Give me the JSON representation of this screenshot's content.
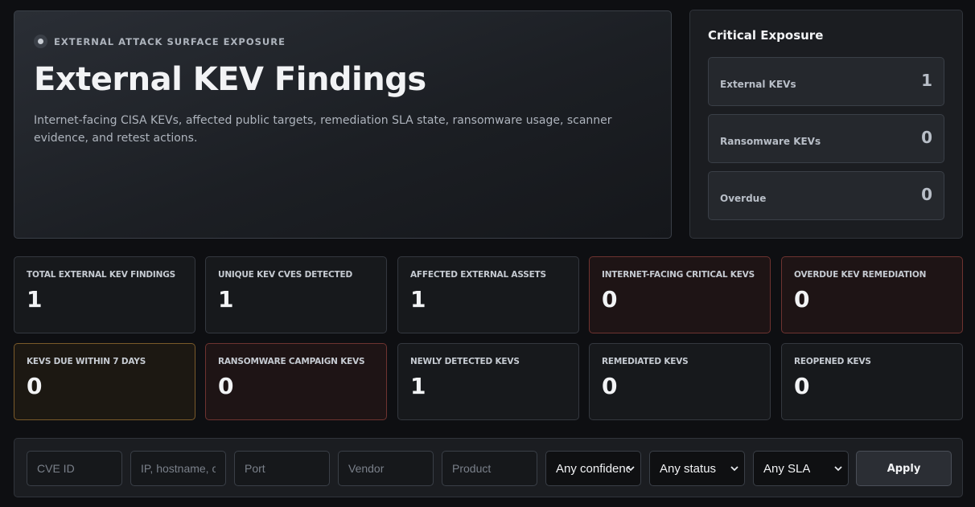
{
  "hero": {
    "eyebrow": "EXTERNAL ATTACK SURFACE EXPOSURE",
    "title": "External KEV Findings",
    "description": "Internet-facing CISA KEVs, affected public targets, remediation SLA state, ransomware usage, scanner evidence, and retest actions."
  },
  "critical": {
    "title": "Critical Exposure",
    "rows": [
      {
        "label": "External KEVs",
        "value": "1"
      },
      {
        "label": "Ransomware KEVs",
        "value": "0"
      },
      {
        "label": "Overdue",
        "value": "0"
      }
    ]
  },
  "metrics": [
    {
      "label": "TOTAL EXTERNAL KEV FINDINGS",
      "value": "1"
    },
    {
      "label": "UNIQUE KEV CVES DETECTED",
      "value": "1"
    },
    {
      "label": "AFFECTED EXTERNAL ASSETS",
      "value": "1"
    },
    {
      "label": "INTERNET-FACING CRITICAL KEVS",
      "value": "0"
    },
    {
      "label": "OVERDUE KEV REMEDIATION",
      "value": "0"
    },
    {
      "label": "KEVS DUE WITHIN 7 DAYS",
      "value": "0"
    },
    {
      "label": "RANSOMWARE CAMPAIGN KEVS",
      "value": "0"
    },
    {
      "label": "NEWLY DETECTED KEVS",
      "value": "1"
    },
    {
      "label": "REMEDIATED KEVS",
      "value": "0"
    },
    {
      "label": "REOPENED KEVS",
      "value": "0"
    }
  ],
  "filters": {
    "cve_placeholder": "CVE ID",
    "target_placeholder": "IP, hostname, c",
    "port_placeholder": "Port",
    "vendor_placeholder": "Vendor",
    "product_placeholder": "Product",
    "confidence_value": "Any confidence",
    "status_value": "Any status",
    "sla_value": "Any SLA",
    "apply_label": "Apply"
  },
  "colors": {
    "alert_border": "#6e3330",
    "warning_border": "#7a5a2a"
  }
}
